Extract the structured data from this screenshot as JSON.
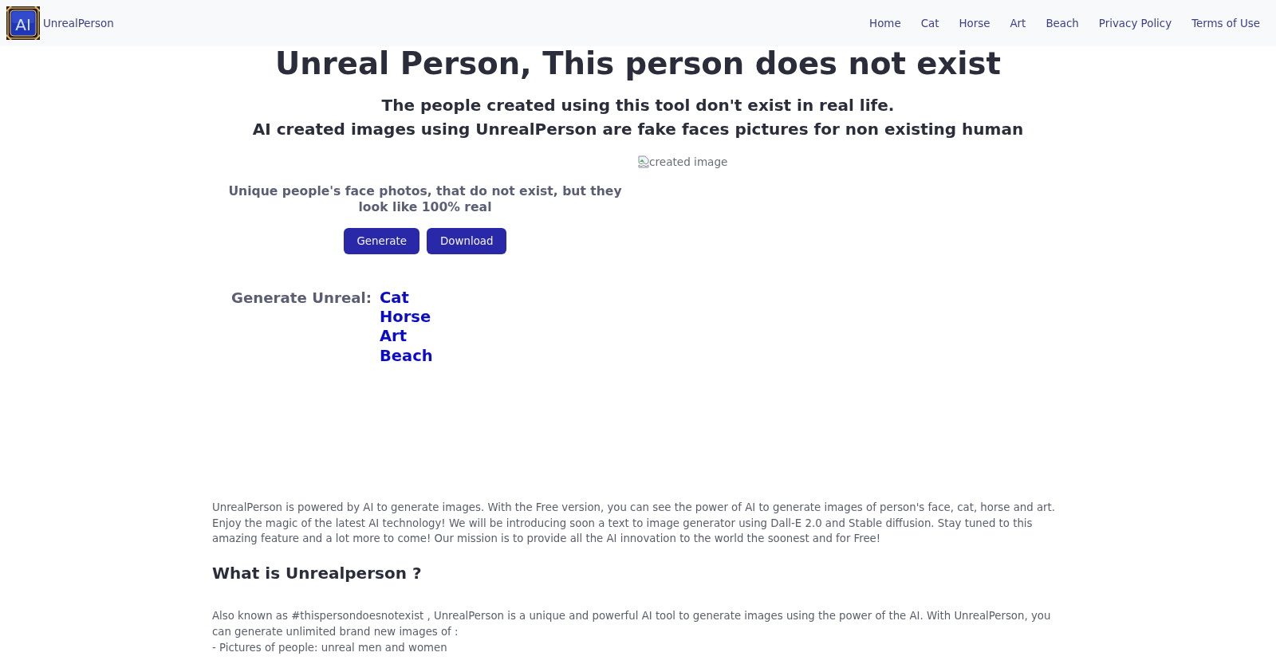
{
  "navbar": {
    "logo_text": "AI",
    "brand": "UnrealPerson",
    "links": [
      "Home",
      "Cat",
      "Horse",
      "Art",
      "Beach",
      "Privacy Policy",
      "Terms of Use"
    ]
  },
  "hero": {
    "title": "Unreal Person, This person does not exist",
    "subtitle_lines": [
      "The people created using this tool don't exist in real life.",
      "AI created images using UnrealPerson are fake faces pictures for non existing human"
    ]
  },
  "generator": {
    "tagline": "Unique people's face photos, that do not exist, but they look like 100% real",
    "buttons": [
      "Generate",
      "Download"
    ],
    "image_alt": "created image",
    "generate_unreal": {
      "label": "Generate Unreal:",
      "links": [
        "Cat",
        "Horse",
        "Art",
        "Beach"
      ]
    }
  },
  "about": {
    "paragraph": "UnrealPerson is powered by AI to generate images. With the Free version, you can see the power of AI to generate images of person's face, cat, horse and art. Enjoy the magic of the latest AI technology! We will be introducing soon a text to image generator using Dall-E 2.0 and Stable diffusion. Stay tuned to this amazing feature and a lot more to come! Our mission is to provide all the AI innovation to the world the soonest and for Free!",
    "heading": "What is Unrealperson ?",
    "intro": "Also known as #thispersondoesnotexist , UnrealPerson is a unique and powerful AI tool to generate images using the power of the AI. With UnrealPerson, you can generate unlimited brand new images of :",
    "list_items": [
      "- Pictures of people: unreal men and women"
    ]
  }
}
